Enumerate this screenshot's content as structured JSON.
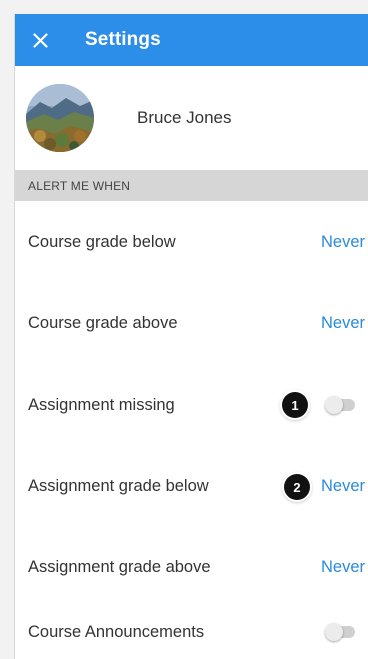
{
  "header": {
    "title": "Settings"
  },
  "profile": {
    "name": "Bruce Jones"
  },
  "section": {
    "title": "ALERT ME WHEN"
  },
  "settings": [
    {
      "label": "Course grade below",
      "value": "Never"
    },
    {
      "label": "Course grade above",
      "value": "Never"
    },
    {
      "label": "Assignment missing",
      "toggle": "off"
    },
    {
      "label": "Assignment grade below",
      "value": "Never"
    },
    {
      "label": "Assignment grade above",
      "value": "Never"
    },
    {
      "label": "Course Announcements",
      "toggle": "off"
    }
  ],
  "markers": [
    {
      "number": "1"
    },
    {
      "number": "2"
    }
  ],
  "icons": {
    "close": "close-icon"
  },
  "colors": {
    "appbar": "#2c8ee8",
    "link": "#2b8ad9",
    "section_bg": "#d6d6d6"
  }
}
